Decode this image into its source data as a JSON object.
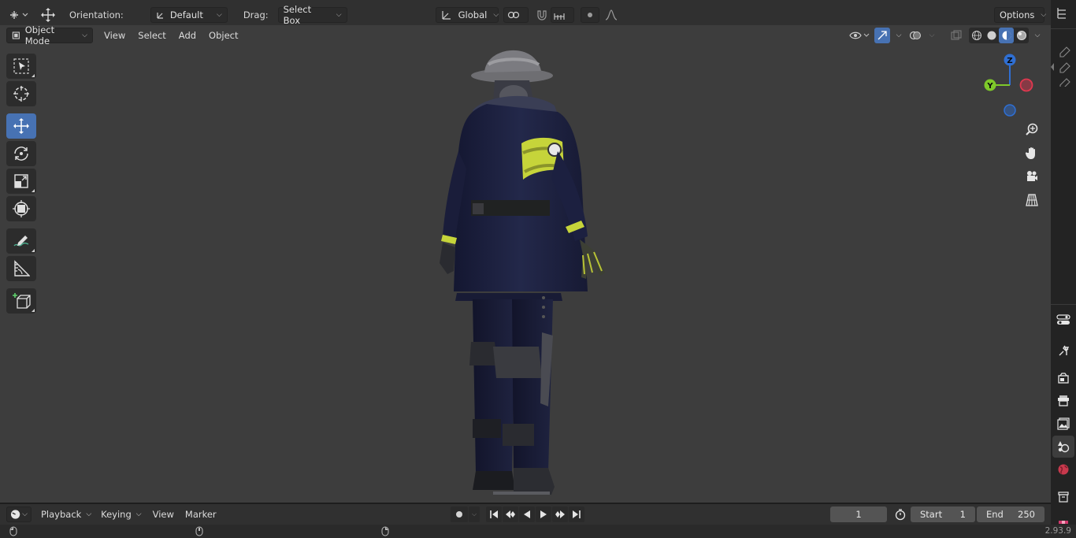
{
  "tool_settings": {
    "orientation_label": "Orientation:",
    "orientation_value": "Default",
    "drag_label": "Drag:",
    "drag_value": "Select Box",
    "transform_space": "Global",
    "options_label": "Options"
  },
  "viewport_header": {
    "mode": "Object Mode",
    "menus": [
      "View",
      "Select",
      "Add",
      "Object"
    ]
  },
  "toolbar": {
    "tools": [
      {
        "name": "select-box-icon",
        "active": false
      },
      {
        "name": "cursor-icon",
        "active": false
      },
      {
        "name": "move-icon",
        "active": true
      },
      {
        "name": "rotate-icon",
        "active": false
      },
      {
        "name": "scale-icon",
        "active": false
      },
      {
        "name": "transform-icon",
        "active": false
      },
      {
        "name": "annotate-icon",
        "active": false
      },
      {
        "name": "measure-icon",
        "active": false
      },
      {
        "name": "add-cube-icon",
        "active": false
      }
    ]
  },
  "gizmo": {
    "z_label": "Z",
    "y_label": "Y",
    "colors": {
      "z": "#2f6fd3",
      "y": "#7ec92a",
      "x": "#e0384f"
    }
  },
  "timeline": {
    "menus": [
      "Playback",
      "Keying",
      "View",
      "Marker"
    ],
    "current_frame": "1",
    "start_label": "Start",
    "start_value": "1",
    "end_label": "End",
    "end_value": "250"
  },
  "status": {
    "version": "2.93.9"
  },
  "colors": {
    "accent": "#4772b3",
    "viewport_bg": "#3d3d3d",
    "armband": "#d7e23a"
  }
}
